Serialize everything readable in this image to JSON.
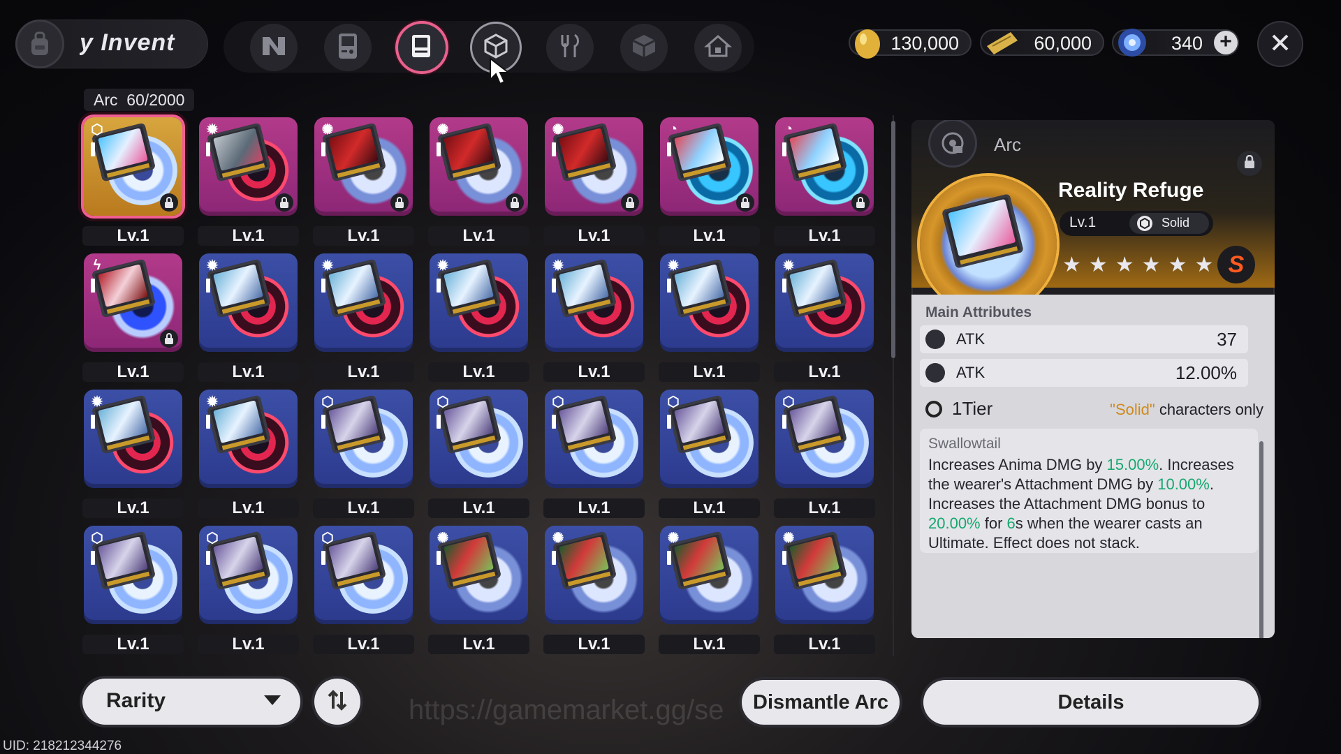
{
  "header": {
    "title": "y Invent",
    "categories": [
      {
        "name": "n-logo",
        "active": false
      },
      {
        "name": "gameboy",
        "active": false
      },
      {
        "name": "arc-cartridge",
        "active": true
      },
      {
        "name": "cube",
        "active": false,
        "hover": true
      },
      {
        "name": "fork-knife",
        "active": false
      },
      {
        "name": "box",
        "active": false
      },
      {
        "name": "house",
        "active": false
      }
    ],
    "currencies": [
      {
        "icon": "gold-egg-icon",
        "value": "130,000"
      },
      {
        "icon": "ticket-icon",
        "value": "60,000"
      },
      {
        "icon": "crystal-icon",
        "value": "340"
      }
    ]
  },
  "inventory": {
    "category_label": "Arc",
    "count": "60/2000"
  },
  "grid": {
    "items": [
      {
        "level": "Lv.1",
        "rarity": "gold",
        "type": "cube",
        "art": "a",
        "disc": "ice",
        "locked": true,
        "selected": true
      },
      {
        "level": "Lv.1",
        "rarity": "pink",
        "type": "gear",
        "art": "b",
        "disc": "red",
        "locked": true
      },
      {
        "level": "Lv.1",
        "rarity": "pink",
        "type": "swirl",
        "art": "c",
        "disc": "swirl",
        "locked": true
      },
      {
        "level": "Lv.1",
        "rarity": "pink",
        "type": "swirl",
        "art": "c",
        "disc": "swirl",
        "locked": true
      },
      {
        "level": "Lv.1",
        "rarity": "pink",
        "type": "swirl",
        "art": "c",
        "disc": "swirl",
        "locked": true
      },
      {
        "level": "Lv.1",
        "rarity": "pink",
        "type": "spiral",
        "art": "d",
        "disc": "cyan",
        "locked": true
      },
      {
        "level": "Lv.1",
        "rarity": "pink",
        "type": "spiral",
        "art": "d",
        "disc": "cyan",
        "locked": true
      },
      {
        "level": "Lv.1",
        "rarity": "pink",
        "type": "bolt",
        "art": "e",
        "disc": "bolt",
        "locked": true
      },
      {
        "level": "Lv.1",
        "rarity": "blue",
        "type": "gear",
        "art": "f",
        "disc": "red"
      },
      {
        "level": "Lv.1",
        "rarity": "blue",
        "type": "gear",
        "art": "f",
        "disc": "red"
      },
      {
        "level": "Lv.1",
        "rarity": "blue",
        "type": "gear",
        "art": "f",
        "disc": "red"
      },
      {
        "level": "Lv.1",
        "rarity": "blue",
        "type": "gear",
        "art": "f",
        "disc": "red"
      },
      {
        "level": "Lv.1",
        "rarity": "blue",
        "type": "gear",
        "art": "f",
        "disc": "red"
      },
      {
        "level": "Lv.1",
        "rarity": "blue",
        "type": "gear",
        "art": "f",
        "disc": "red"
      },
      {
        "level": "Lv.1",
        "rarity": "blue",
        "type": "gear",
        "art": "f",
        "disc": "red"
      },
      {
        "level": "Lv.1",
        "rarity": "blue",
        "type": "gear",
        "art": "f",
        "disc": "red"
      },
      {
        "level": "Lv.1",
        "rarity": "blue",
        "type": "cube",
        "art": "g",
        "disc": "ice"
      },
      {
        "level": "Lv.1",
        "rarity": "blue",
        "type": "cube",
        "art": "g",
        "disc": "ice"
      },
      {
        "level": "Lv.1",
        "rarity": "blue",
        "type": "cube",
        "art": "g",
        "disc": "ice"
      },
      {
        "level": "Lv.1",
        "rarity": "blue",
        "type": "cube",
        "art": "g",
        "disc": "ice"
      },
      {
        "level": "Lv.1",
        "rarity": "blue",
        "type": "cube",
        "art": "g",
        "disc": "ice"
      },
      {
        "level": "Lv.1",
        "rarity": "blue",
        "type": "cube",
        "art": "g",
        "disc": "ice"
      },
      {
        "level": "Lv.1",
        "rarity": "blue",
        "type": "cube",
        "art": "g",
        "disc": "ice"
      },
      {
        "level": "Lv.1",
        "rarity": "blue",
        "type": "cube",
        "art": "g",
        "disc": "ice"
      },
      {
        "level": "Lv.1",
        "rarity": "blue",
        "type": "swirl",
        "art": "h",
        "disc": "swirl"
      },
      {
        "level": "Lv.1",
        "rarity": "blue",
        "type": "swirl",
        "art": "h",
        "disc": "swirl"
      },
      {
        "level": "Lv.1",
        "rarity": "blue",
        "type": "swirl",
        "art": "h",
        "disc": "swirl"
      },
      {
        "level": "Lv.1",
        "rarity": "blue",
        "type": "swirl",
        "art": "h",
        "disc": "swirl"
      }
    ]
  },
  "detail": {
    "category": "Arc",
    "name": "Reality Refuge",
    "level": "Lv.1",
    "tag": "Solid",
    "stars": "★★★★★★",
    "rank_badge": "S",
    "section_title": "Main Attributes",
    "attributes": [
      {
        "name": "ATK",
        "value": "37"
      },
      {
        "name": "ATK",
        "value": "12.00%"
      }
    ],
    "tier": "1Tier",
    "requirement_quoted": "\"Solid\"",
    "requirement_rest": " characters only",
    "effect_name": "Swallowtail",
    "effect_parts": [
      {
        "t": "Increases Anima DMG by "
      },
      {
        "t": "15.00%",
        "hl": true
      },
      {
        "t": ". Increases the wearer's Attachment DMG by "
      },
      {
        "t": "10.00%",
        "hl": true
      },
      {
        "t": ". Increases the Attachment DMG bonus to "
      },
      {
        "t": "20.00%",
        "hl": true
      },
      {
        "t": " for "
      },
      {
        "t": "6",
        "hl": true
      },
      {
        "t": "s when the wearer casts an Ultimate. Effect does not stack."
      }
    ]
  },
  "footer": {
    "rarity_label": "Rarity",
    "watermark": "https://gamemarket.gg/se",
    "dismantle_label": "Dismantle Arc",
    "details_label": "Details",
    "uid": "UID: 218212344276"
  },
  "colors": {
    "accent_pink": "#f05e92",
    "highlight_green": "#17a86f",
    "quote_orange": "#d08a1c"
  }
}
